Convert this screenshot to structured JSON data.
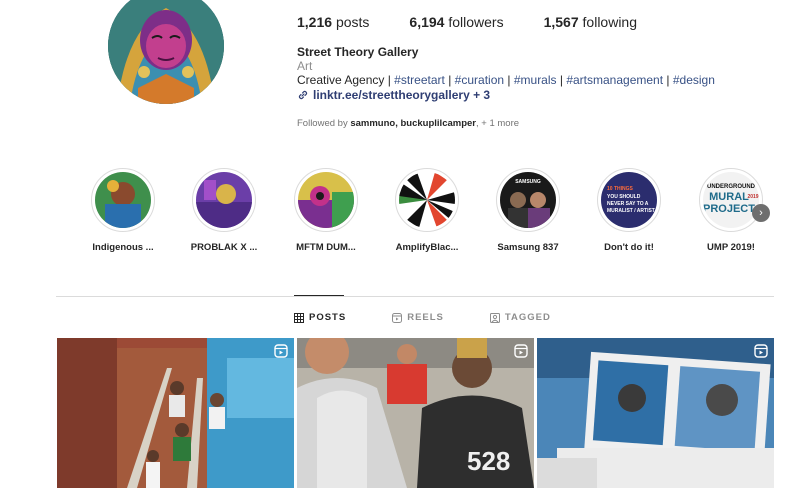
{
  "profile": {
    "stats": [
      {
        "count": "1,216",
        "label": "posts"
      },
      {
        "count": "6,194",
        "label": "followers"
      },
      {
        "count": "1,567",
        "label": "following"
      }
    ],
    "name": "Street Theory Gallery",
    "category": "Art",
    "bio_prefix": "Creative Agency | ",
    "hashtags": [
      "#streetart",
      "#curation",
      "#murals",
      "#artsmanagement",
      "#design"
    ],
    "link": "linktr.ee/streettheorygallery + 3",
    "followed_by_prefix": "Followed by ",
    "followed_by_users": "sammuno, buckuplilcamper",
    "followed_by_more": ", + 1 more"
  },
  "highlights": [
    {
      "label": "Indigenous ..."
    },
    {
      "label": "PROBLAK X ..."
    },
    {
      "label": "MFTM DUM..."
    },
    {
      "label": "AmplifyBlac..."
    },
    {
      "label": "Samsung 837"
    },
    {
      "label": "Don't do it!"
    },
    {
      "label": "UMP 2019!"
    }
  ],
  "highlight_texts": {
    "samsung": "SAMSUNG",
    "dont_line1": "10 THINGS",
    "dont_line2": "YOU SHOULD",
    "dont_line3": "NEVER SAY TO A",
    "dont_line4": "MURALIST / ARTIST.",
    "ump_line1": "UNDERGROUND",
    "ump_line2": "MURAL",
    "ump_line3": "PROJECT",
    "ump_year": "2019"
  },
  "tabs": [
    {
      "label": "POSTS",
      "icon": "grid-icon",
      "active": true
    },
    {
      "label": "REELS",
      "icon": "reels-icon",
      "active": false
    },
    {
      "label": "TAGGED",
      "icon": "tagged-icon",
      "active": false
    }
  ],
  "post_texts": {
    "jersey_number": "528"
  },
  "colors": {
    "hashtag": "#385185",
    "link": "#2f3e73",
    "muted": "#8e8e8e"
  }
}
